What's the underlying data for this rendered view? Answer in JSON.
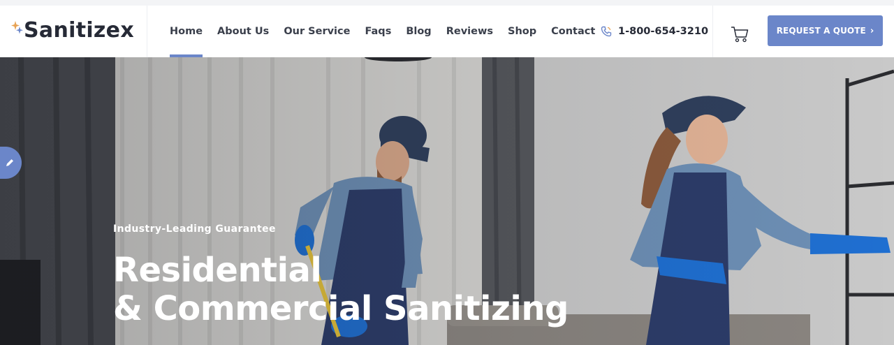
{
  "brand": {
    "name": "Sanitizex",
    "accent": "#6b86c9",
    "sparkle_colors": [
      "#e8a355",
      "#6b86c9"
    ]
  },
  "nav": {
    "items": [
      {
        "label": "Home",
        "active": true
      },
      {
        "label": "About Us",
        "active": false
      },
      {
        "label": "Our Service",
        "active": false
      },
      {
        "label": "Faqs",
        "active": false
      },
      {
        "label": "Blog",
        "active": false
      },
      {
        "label": "Reviews",
        "active": false
      },
      {
        "label": "Shop",
        "active": false
      },
      {
        "label": "Contact",
        "active": false
      }
    ]
  },
  "header": {
    "phone": "1-800-654-3210",
    "phone_icon": "phone-icon",
    "cart_icon": "cart-icon",
    "quote_label": "REQUEST A QUOTE",
    "quote_icon": "chevron-right-icon"
  },
  "hero": {
    "eyebrow": "Industry-Leading Guarantee",
    "headline_line1": "Residential",
    "headline_line2": "& Commercial Sanitizing",
    "side_tab_icon": "pencil-icon"
  }
}
